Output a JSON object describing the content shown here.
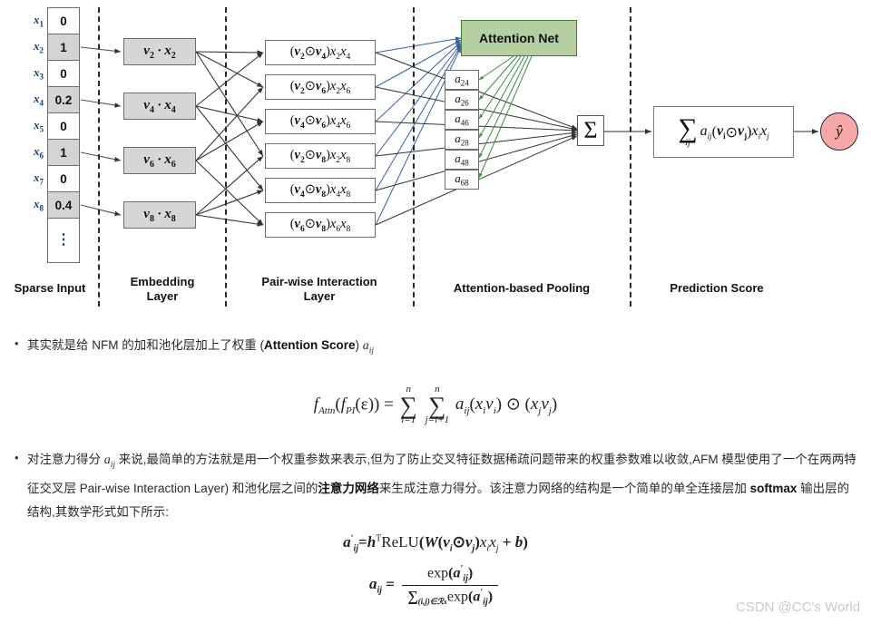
{
  "diagram": {
    "title": "AFM architecture",
    "sparse_input": {
      "labels": [
        "x1",
        "x2",
        "x3",
        "x4",
        "x5",
        "x6",
        "x7",
        "x8"
      ],
      "label_parts": [
        {
          "base": "x",
          "sub": "1"
        },
        {
          "base": "x",
          "sub": "2"
        },
        {
          "base": "x",
          "sub": "3"
        },
        {
          "base": "x",
          "sub": "4"
        },
        {
          "base": "x",
          "sub": "5"
        },
        {
          "base": "x",
          "sub": "6"
        },
        {
          "base": "x",
          "sub": "7"
        },
        {
          "base": "x",
          "sub": "8"
        }
      ],
      "values": [
        "0",
        "1",
        "0",
        "0.2",
        "0",
        "1",
        "0",
        "0.4"
      ],
      "filled": [
        false,
        true,
        false,
        true,
        false,
        true,
        false,
        true
      ],
      "ellipsis": "⋮"
    },
    "embedding": [
      {
        "v": "v",
        "vsub": "2",
        "x": "x",
        "xsub": "2"
      },
      {
        "v": "v",
        "vsub": "4",
        "x": "x",
        "xsub": "4"
      },
      {
        "v": "v",
        "vsub": "6",
        "x": "x",
        "xsub": "6"
      },
      {
        "v": "v",
        "vsub": "8",
        "x": "x",
        "xsub": "8"
      }
    ],
    "pairwise": [
      {
        "a": "2",
        "b": "4"
      },
      {
        "a": "2",
        "b": "6"
      },
      {
        "a": "4",
        "b": "6"
      },
      {
        "a": "2",
        "b": "8"
      },
      {
        "a": "4",
        "b": "8"
      },
      {
        "a": "6",
        "b": "8"
      }
    ],
    "attention_net_label": "Attention Net",
    "attention_weights": [
      "24",
      "26",
      "46",
      "28",
      "48",
      "68"
    ],
    "sigma_symbol": "Σ",
    "prediction_sum_symbol": "∑",
    "prediction_sum_sub": "ij",
    "prediction_body": "a",
    "output_label": "ŷ",
    "stage_labels": [
      "Sparse Input",
      "Embedding\nLayer",
      "Pair-wise Interaction\nLayer",
      "Attention-based Pooling",
      "Prediction Score"
    ],
    "colors": {
      "attention_net_fill": "#b5cfa1",
      "attention_net_border": "#4a7a32",
      "embedding_fill": "#d6d6d6",
      "output_fill": "#f7a7a7",
      "blue_edge": "#3a5fa8",
      "green_edge": "#3f8f3f",
      "black_edge": "#333333"
    }
  },
  "body": {
    "bullet1": {
      "marker": "•",
      "text_before": "其实就是给 NFM 的加和池化层加上了权重 (",
      "bold": "Attention Score",
      "text_after": ")",
      "math_var": "a",
      "math_sub": "ij"
    },
    "equation1": {
      "lhs": "f",
      "lhs_sub": "Attn",
      "inner": "(f",
      "inner_sub": "PI",
      "inner_arg": "(ε)) =",
      "sum1_upper": "n",
      "sum1_symbol": "∑",
      "sum1_lower": "i=1",
      "sum2_upper": "n",
      "sum2_symbol": "∑",
      "sum2_lower": "j=i+1",
      "tail_a": "a",
      "tail_a_sub": "ij",
      "tail_rest": "(x",
      "tail_rest2": "v",
      "tail_odot": "⊙",
      "full": "f_Attn(f_PI(ε)) = Σ_{i=1}^{n} Σ_{j=i+1}^{n} a_ij (x_i v_i) ⊙ (x_j v_j)"
    },
    "bullet2": {
      "marker": "•",
      "line1_a": "对注意力得分 ",
      "line1_math": "a",
      "line1_math_sub": "ij",
      "line1_b": " 来说,最简单的方法就是用一个权重参数来表示,但为了防止交叉特征数据稀疏问题带来的权重参数难以收敛,",
      "line2_a": "AFM 模型使用了一个在两两特征交叉层 Pair-wise Interaction Layer) 和池化层之间的",
      "line2_bold": "注意力网络",
      "line2_b": "来生成注意力得分。该注意力网络",
      "line3_a": "的结构是一个简单的单全连接层加 ",
      "line3_bold": "softmax",
      "line3_b": " 输出层的结构,其数学形式如下所示:"
    },
    "equation2": {
      "lhs": "a",
      "lhs_sub": "ij",
      "lhs_prime": "′",
      "eq": "=",
      "h": "h",
      "h_sup": "T",
      "relu": "ReLU",
      "paren_open": "(",
      "W": "W",
      "v1": "v",
      "v1_sub": "i",
      "odot": "⊙",
      "v2": "v",
      "v2_sub": "j",
      "x_terms": "x",
      "plus": "+",
      "b": "b",
      "paren_close": ")"
    },
    "equation3": {
      "lhs": "a",
      "lhs_sub": "ij",
      "eq": "=",
      "numerator": "exp(a′ij)",
      "denominator": "∑(i,j)∈ℛx exp(a′ij)"
    }
  },
  "watermark": "CSDN @CC's World"
}
